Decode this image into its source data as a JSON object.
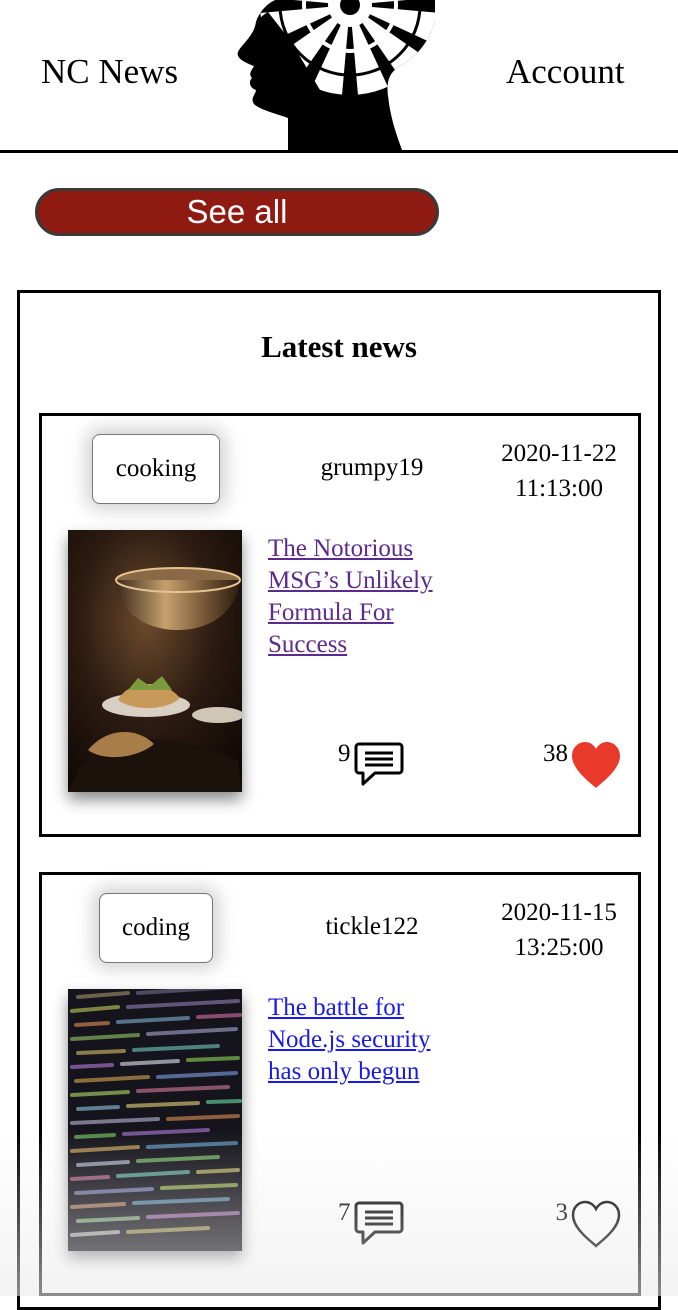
{
  "header": {
    "brand": "NC News",
    "account_label": "Account",
    "logo_icon": "hypnotic-head-logo-icon"
  },
  "see_all_label": "See all",
  "news": {
    "title": "Latest news",
    "articles": [
      {
        "topic": "cooking",
        "author": "grumpy19",
        "date": "2020-11-22",
        "time": "11:13:00",
        "title_lines": [
          "The Notorious",
          "MSG’s Unlikely",
          "Formula For",
          "Success"
        ],
        "comment_count": "9",
        "votes": "38",
        "liked": true,
        "image_icon": "food-photo"
      },
      {
        "topic": "coding",
        "author": "tickle122",
        "date": "2020-11-15",
        "time": "13:25:00",
        "title_lines": [
          "The battle for",
          "Node.js security",
          "has only begun"
        ],
        "comment_count": "7",
        "votes": "3",
        "liked": false,
        "image_icon": "code-screen-photo"
      }
    ]
  },
  "colors": {
    "button_bg": "#8f1a12",
    "heart_filled": "#e8392b",
    "link_visited": "#5b2a8c",
    "link_unvisited": "#1a1ae6"
  }
}
